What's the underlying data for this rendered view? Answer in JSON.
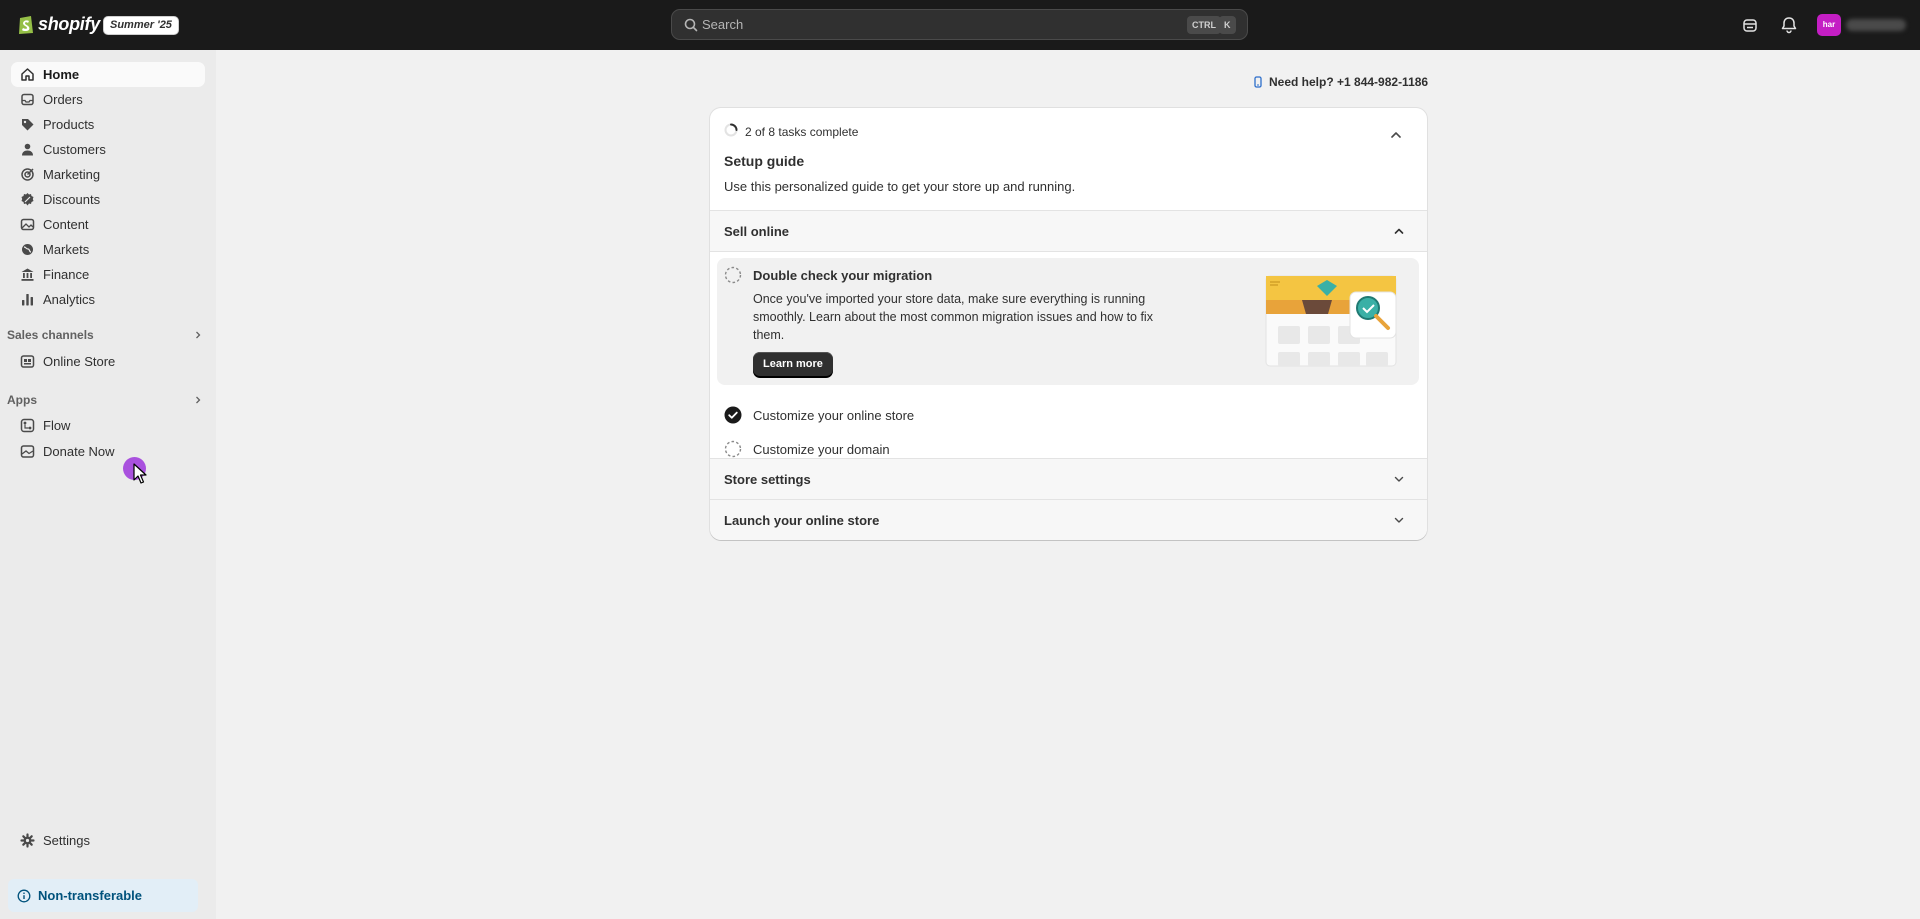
{
  "topbar": {
    "logo_text": "shopify",
    "edition_badge": "Summer '25",
    "search": {
      "placeholder": "Search",
      "shortcut_ctrl": "CTRL",
      "shortcut_key": "K"
    },
    "avatar_initials": "har",
    "icons": [
      "store-icon",
      "bell-icon"
    ]
  },
  "sidebar": {
    "items": [
      {
        "label": "Home",
        "icon": "home-icon",
        "active": true
      },
      {
        "label": "Orders",
        "icon": "inbox-icon"
      },
      {
        "label": "Products",
        "icon": "tag-icon"
      },
      {
        "label": "Customers",
        "icon": "person-icon"
      },
      {
        "label": "Marketing",
        "icon": "target-icon"
      },
      {
        "label": "Discounts",
        "icon": "discount-icon"
      },
      {
        "label": "Content",
        "icon": "image-icon"
      },
      {
        "label": "Markets",
        "icon": "globe-icon"
      },
      {
        "label": "Finance",
        "icon": "bank-icon"
      },
      {
        "label": "Analytics",
        "icon": "bar-chart-icon"
      }
    ],
    "sales_channels": {
      "heading": "Sales channels",
      "items": [
        {
          "label": "Online Store",
          "icon": "storefront-icon"
        }
      ]
    },
    "apps": {
      "heading": "Apps",
      "items": [
        {
          "label": "Flow",
          "icon": "flow-icon"
        },
        {
          "label": "Donate Now",
          "icon": "app-icon"
        }
      ]
    },
    "settings_label": "Settings",
    "non_transferable_label": "Non-transferable"
  },
  "help": {
    "label": "Need help? +1 844-982-1186"
  },
  "setup_guide": {
    "progress_text": "2 of 8 tasks complete",
    "tasks_completed": 2,
    "tasks_total": 8,
    "title": "Setup guide",
    "subtitle": "Use this personalized guide to get your store up and running.",
    "sections": [
      {
        "label": "Sell online",
        "expanded": true,
        "tasks": [
          {
            "title": "Double check your migration",
            "description": "Once you've imported your store data, make sure everything is running smoothly. Learn about the most common migration issues and how to fix them.",
            "button_label": "Learn more",
            "completed": false,
            "expanded": true
          },
          {
            "title": "Customize your online store",
            "completed": true
          },
          {
            "title": "Customize your domain",
            "completed": false
          }
        ]
      },
      {
        "label": "Store settings",
        "expanded": false
      },
      {
        "label": "Launch your online store",
        "expanded": false
      }
    ]
  },
  "colors": {
    "topbar": "#1a1a1a",
    "sidebar": "#ebebeb",
    "page": "#f1f1f1",
    "info_banner": "#e2eef7",
    "avatar": "#c41ec4",
    "cursor_highlight": "#9e36dc"
  }
}
